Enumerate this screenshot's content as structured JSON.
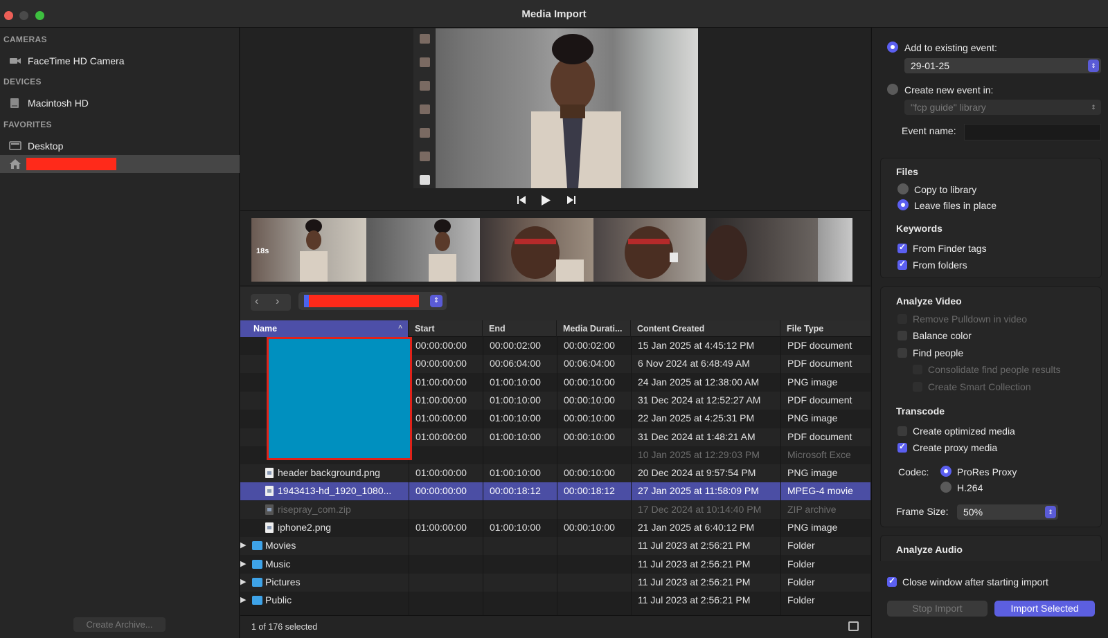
{
  "window": {
    "title": "Media Import"
  },
  "sidebar": {
    "sections": [
      {
        "label": "CAMERAS",
        "items": [
          {
            "label": "FaceTime HD Camera",
            "icon": "camera-icon"
          }
        ]
      },
      {
        "label": "DEVICES",
        "items": [
          {
            "label": "Macintosh HD",
            "icon": "disk-icon"
          }
        ]
      },
      {
        "label": "FAVORITES",
        "items": [
          {
            "label": "Desktop",
            "icon": "desktop-icon"
          }
        ]
      }
    ],
    "home_icon": "home-icon",
    "create_archive": "Create Archive..."
  },
  "player": {
    "prev_icon": "skip-back-icon",
    "play_icon": "play-icon",
    "next_icon": "skip-forward-icon",
    "filmstrip_duration_badge": "18s"
  },
  "browser": {
    "back_icon": "chevron-left-icon",
    "forward_icon": "chevron-right-icon",
    "columns": [
      "Name",
      "Start",
      "End",
      "Media Durati...",
      "Content Created",
      "File Type"
    ],
    "rows": [
      {
        "name": "",
        "start": "00:00:00:00",
        "end": "00:00:02:00",
        "duration": "00:00:02:00",
        "created": "15 Jan 2025 at 4:45:12 PM",
        "type": "PDF document",
        "kind": "hidden"
      },
      {
        "name": "",
        "start": "00:00:00:00",
        "end": "00:06:04:00",
        "duration": "00:06:04:00",
        "created": "6 Nov 2024 at 6:48:49 AM",
        "type": "PDF document",
        "kind": "hidden"
      },
      {
        "name": "",
        "start": "01:00:00:00",
        "end": "01:00:10:00",
        "duration": "00:00:10:00",
        "created": "24 Jan 2025 at 12:38:00 AM",
        "type": "PNG image",
        "kind": "hidden"
      },
      {
        "name": "",
        "start": "01:00:00:00",
        "end": "01:00:10:00",
        "duration": "00:00:10:00",
        "created": "31 Dec 2024 at 12:52:27 AM",
        "type": "PDF document",
        "kind": "hidden"
      },
      {
        "name": "",
        "start": "01:00:00:00",
        "end": "01:00:10:00",
        "duration": "00:00:10:00",
        "created": "22 Jan 2025 at 4:25:31 PM",
        "type": "PNG image",
        "kind": "hidden"
      },
      {
        "name": "",
        "start": "01:00:00:00",
        "end": "01:00:10:00",
        "duration": "00:00:10:00",
        "created": "31 Dec 2024 at 1:48:21 AM",
        "type": "PDF document",
        "kind": "hidden"
      },
      {
        "name": "",
        "start": "",
        "end": "",
        "duration": "",
        "created": "10 Jan 2025 at 12:29:03 PM",
        "type": "Microsoft Exce",
        "kind": "dim"
      },
      {
        "name": "header background.png",
        "start": "01:00:00:00",
        "end": "01:00:10:00",
        "duration": "00:00:10:00",
        "created": "20 Dec 2024 at 9:57:54 PM",
        "type": "PNG image",
        "kind": "file"
      },
      {
        "name": "1943413-hd_1920_1080...",
        "start": "00:00:00:00",
        "end": "00:00:18:12",
        "duration": "00:00:18:12",
        "created": "27 Jan 2025 at 11:58:09 PM",
        "type": "MPEG-4 movie",
        "kind": "selected"
      },
      {
        "name": "risepray_com.zip",
        "start": "",
        "end": "",
        "duration": "",
        "created": "17 Dec 2024 at 10:14:40 PM",
        "type": "ZIP archive",
        "kind": "dimfile"
      },
      {
        "name": "iphone2.png",
        "start": "01:00:00:00",
        "end": "01:00:10:00",
        "duration": "00:00:10:00",
        "created": "21 Jan 2025 at 6:40:12 PM",
        "type": "PNG image",
        "kind": "file"
      },
      {
        "name": "Movies",
        "start": "",
        "end": "",
        "duration": "",
        "created": "11 Jul 2023 at 2:56:21 PM",
        "type": "Folder",
        "kind": "folder"
      },
      {
        "name": "Music",
        "start": "",
        "end": "",
        "duration": "",
        "created": "11 Jul 2023 at 2:56:21 PM",
        "type": "Folder",
        "kind": "folder"
      },
      {
        "name": "Pictures",
        "start": "",
        "end": "",
        "duration": "",
        "created": "11 Jul 2023 at 2:56:21 PM",
        "type": "Folder",
        "kind": "folder"
      },
      {
        "name": "Public",
        "start": "",
        "end": "",
        "duration": "",
        "created": "11 Jul 2023 at 2:56:21 PM",
        "type": "Folder",
        "kind": "folder"
      }
    ],
    "status": "1 of 176 selected",
    "filmstrip_toggle_icon": "filmstrip-icon"
  },
  "options": {
    "add_existing": {
      "label": "Add to existing event:",
      "value": "29-01-25",
      "checked": true
    },
    "create_new": {
      "label": "Create new event in:",
      "value": "\"fcp guide\" library",
      "checked": false
    },
    "event_name_label": "Event name:",
    "event_name_value": "",
    "files": {
      "heading": "Files",
      "copy": "Copy to library",
      "leave": "Leave files in place"
    },
    "keywords": {
      "heading": "Keywords",
      "finder_tags": "From Finder tags",
      "folders": "From folders"
    },
    "analyze_video": {
      "heading": "Analyze Video",
      "remove_pulldown": "Remove Pulldown in video",
      "balance_color": "Balance color",
      "find_people": "Find people",
      "consolidate": "Consolidate find people results",
      "smart_collection": "Create Smart Collection"
    },
    "transcode": {
      "heading": "Transcode",
      "optimized": "Create optimized media",
      "proxy": "Create proxy media",
      "codec_label": "Codec:",
      "codec_prores": "ProRes Proxy",
      "codec_h264": "H.264",
      "frame_size_label": "Frame Size:",
      "frame_size_value": "50%"
    },
    "analyze_audio": {
      "heading": "Analyze Audio"
    },
    "close_window": "Close window after starting import",
    "stop_import": "Stop Import",
    "import_selected": "Import Selected"
  },
  "colors": {
    "accent": "#5c5fe0",
    "selection": "#4b4ea4",
    "redaction": "#ff2a1a",
    "redaction_blue": "#0090bf"
  }
}
